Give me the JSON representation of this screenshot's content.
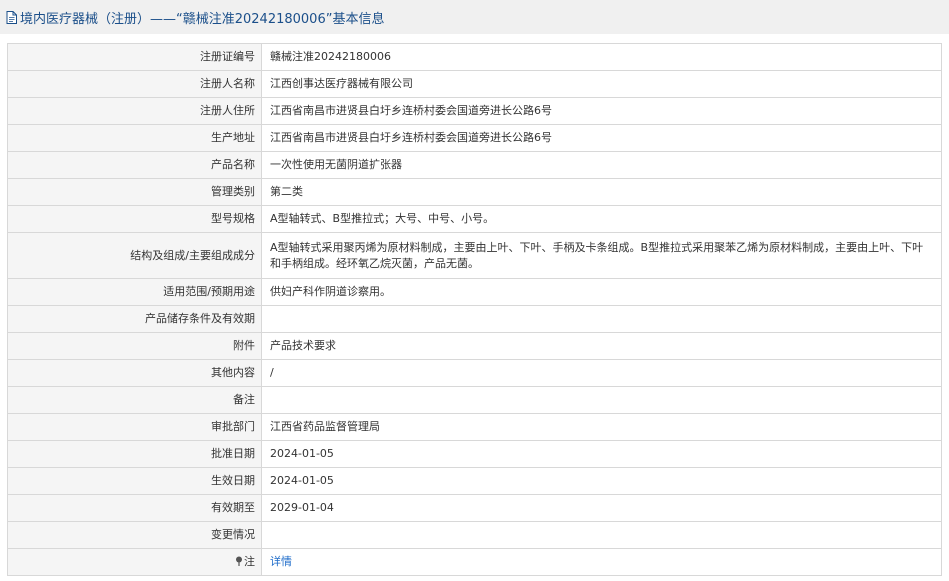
{
  "header": {
    "title": "境内医疗器械（注册）——“赣械注准20242180006”基本信息"
  },
  "rows": [
    {
      "label": "注册证编号",
      "value": "赣械注准20242180006"
    },
    {
      "label": "注册人名称",
      "value": "江西创事达医疗器械有限公司"
    },
    {
      "label": "注册人住所",
      "value": "江西省南昌市进贤县白圩乡连桥村委会国道旁进长公路6号"
    },
    {
      "label": "生产地址",
      "value": "江西省南昌市进贤县白圩乡连桥村委会国道旁进长公路6号"
    },
    {
      "label": "产品名称",
      "value": "一次性使用无菌阴道扩张器"
    },
    {
      "label": "管理类别",
      "value": "第二类"
    },
    {
      "label": "型号规格",
      "value": "A型轴转式、B型推拉式；大号、中号、小号。"
    },
    {
      "label": "结构及组成/主要组成成分",
      "value": "A型轴转式采用聚丙烯为原材料制成，主要由上叶、下叶、手柄及卡条组成。B型推拉式采用聚苯乙烯为原材料制成，主要由上叶、下叶和手柄组成。经环氧乙烷灭菌，产品无菌。"
    },
    {
      "label": "适用范围/预期用途",
      "value": "供妇产科作阴道诊察用。"
    },
    {
      "label": "产品储存条件及有效期",
      "value": ""
    },
    {
      "label": "附件",
      "value": "产品技术要求"
    },
    {
      "label": "其他内容",
      "value": "/"
    },
    {
      "label": "备注",
      "value": ""
    },
    {
      "label": "审批部门",
      "value": "江西省药品监督管理局"
    },
    {
      "label": "批准日期",
      "value": "2024-01-05"
    },
    {
      "label": "生效日期",
      "value": "2024-01-05"
    },
    {
      "label": "有效期至",
      "value": "2029-01-04"
    },
    {
      "label": "变更情况",
      "value": ""
    }
  ],
  "note": {
    "label": "注",
    "link": "详情",
    "icon": "pin-icon"
  },
  "icons": {
    "header": "document-icon"
  },
  "colors": {
    "header_bg": "#f0f0f0",
    "header_text": "#1b4f8a",
    "label_bg": "#f5f5f5",
    "border": "#d8d8d8",
    "link": "#1b6ac9"
  }
}
